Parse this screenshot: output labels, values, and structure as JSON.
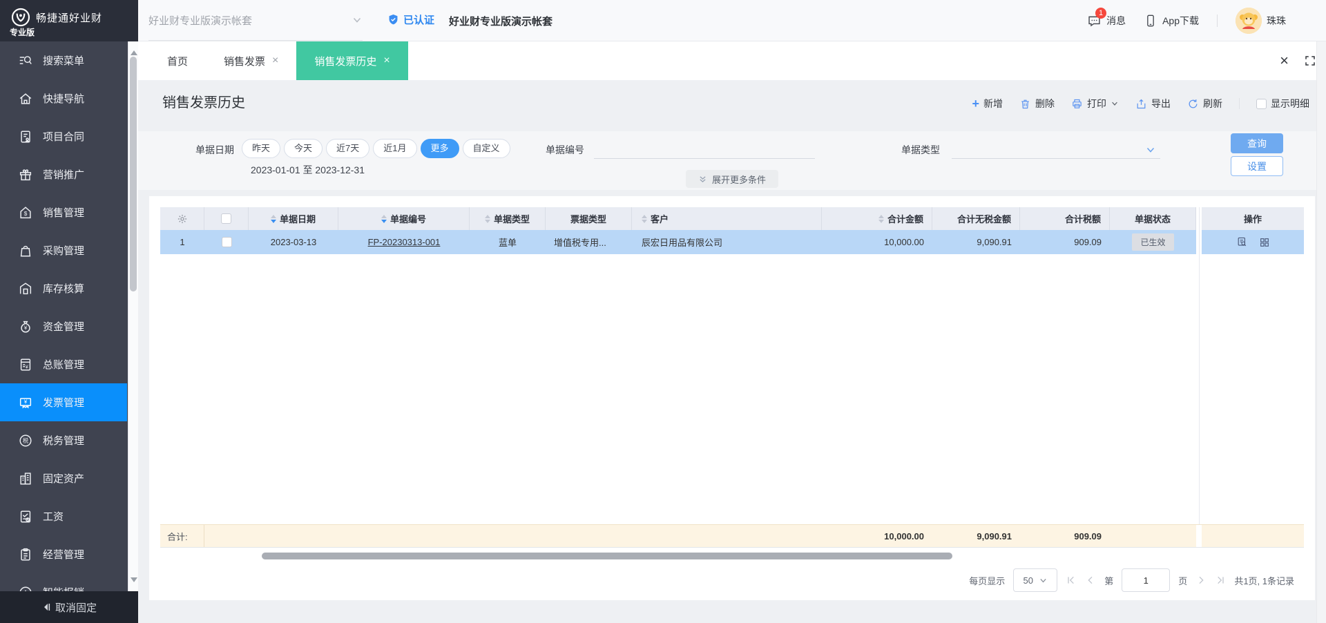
{
  "colors": {
    "accent_blue": "#0a8ffb",
    "active_tab_green": "#41c8a1",
    "selected_row_blue": "#b9d7f7",
    "totals_row_cream": "#fdf4e3",
    "badge_red": "#f5483d",
    "query_button_blue": "#6faaf0"
  },
  "topbar": {
    "logo_title": "畅捷通好业财",
    "logo_subtitle": "专业版",
    "account_selector": "好业财专业版演示帐套",
    "verified_badge": "已认证",
    "workspace_title": "好业财专业版演示帐套",
    "messages_label": "消息",
    "messages_badge_count": "1",
    "app_download_label": "App下载",
    "user_name": "珠珠"
  },
  "sidebar": {
    "items": [
      {
        "label": "搜索菜单",
        "icon": "search-menu-icon"
      },
      {
        "label": "快捷导航",
        "icon": "quick-nav-icon"
      },
      {
        "label": "项目合同",
        "icon": "project-contract-icon"
      },
      {
        "label": "营销推广",
        "icon": "marketing-icon"
      },
      {
        "label": "销售管理",
        "icon": "sales-icon"
      },
      {
        "label": "采购管理",
        "icon": "purchase-icon"
      },
      {
        "label": "库存核算",
        "icon": "inventory-icon"
      },
      {
        "label": "资金管理",
        "icon": "funds-icon"
      },
      {
        "label": "总账管理",
        "icon": "general-ledger-icon"
      },
      {
        "label": "发票管理",
        "icon": "invoice-icon",
        "active": true
      },
      {
        "label": "税务管理",
        "icon": "tax-icon"
      },
      {
        "label": "固定资产",
        "icon": "fixed-assets-icon"
      },
      {
        "label": "工资",
        "icon": "salary-icon"
      },
      {
        "label": "经营管理",
        "icon": "operations-icon"
      },
      {
        "label": "智能报销",
        "icon": "expense-icon",
        "partially_visible": true
      }
    ],
    "unpin_label": "取消固定"
  },
  "tabs": [
    {
      "label": "首页",
      "closable": false
    },
    {
      "label": "销售发票",
      "closable": true
    },
    {
      "label": "销售发票历史",
      "closable": true,
      "active": true
    }
  ],
  "page": {
    "title": "销售发票历史"
  },
  "toolbar": {
    "add": "新增",
    "delete": "删除",
    "print": "打印",
    "export": "导出",
    "refresh": "刷新",
    "show_detail": "显示明细",
    "show_detail_checked": false
  },
  "filters": {
    "date_label": "单据日期",
    "date_options": [
      "昨天",
      "今天",
      "近7天",
      "近1月",
      "更多",
      "自定义"
    ],
    "date_selected": "更多",
    "date_range": "2023-01-01 至 2023-12-31",
    "doc_no_label": "单据编号",
    "doc_no_value": "",
    "doc_type_label": "单据类型",
    "doc_type_value": "",
    "search_button": "查询",
    "settings_button": "设置",
    "expand_more_label": "展开更多条件"
  },
  "table": {
    "columns": [
      "单据日期",
      "单据编号",
      "单据类型",
      "票据类型",
      "客户",
      "合计金额",
      "合计无税金额",
      "合计税额",
      "单据状态",
      "操作"
    ],
    "rows": [
      {
        "index": "1",
        "selected": true,
        "doc_date": "2023-03-13",
        "doc_no": "FP-20230313-001",
        "doc_type": "蓝单",
        "invoice_type": "增值税专用...",
        "customer": "辰宏日用品有限公司",
        "total_amount": "10,000.00",
        "amount_excl_tax": "9,090.91",
        "tax_amount": "909.09",
        "status": "已生效"
      }
    ],
    "totals": {
      "label": "合计:",
      "total_amount": "10,000.00",
      "amount_excl_tax": "9,090.91",
      "tax_amount": "909.09"
    }
  },
  "pagination": {
    "page_size_label": "每页显示",
    "page_size": "50",
    "page_prefix": "第",
    "current_page": "1",
    "page_suffix": "页",
    "summary": "共1页, 1条记录"
  }
}
